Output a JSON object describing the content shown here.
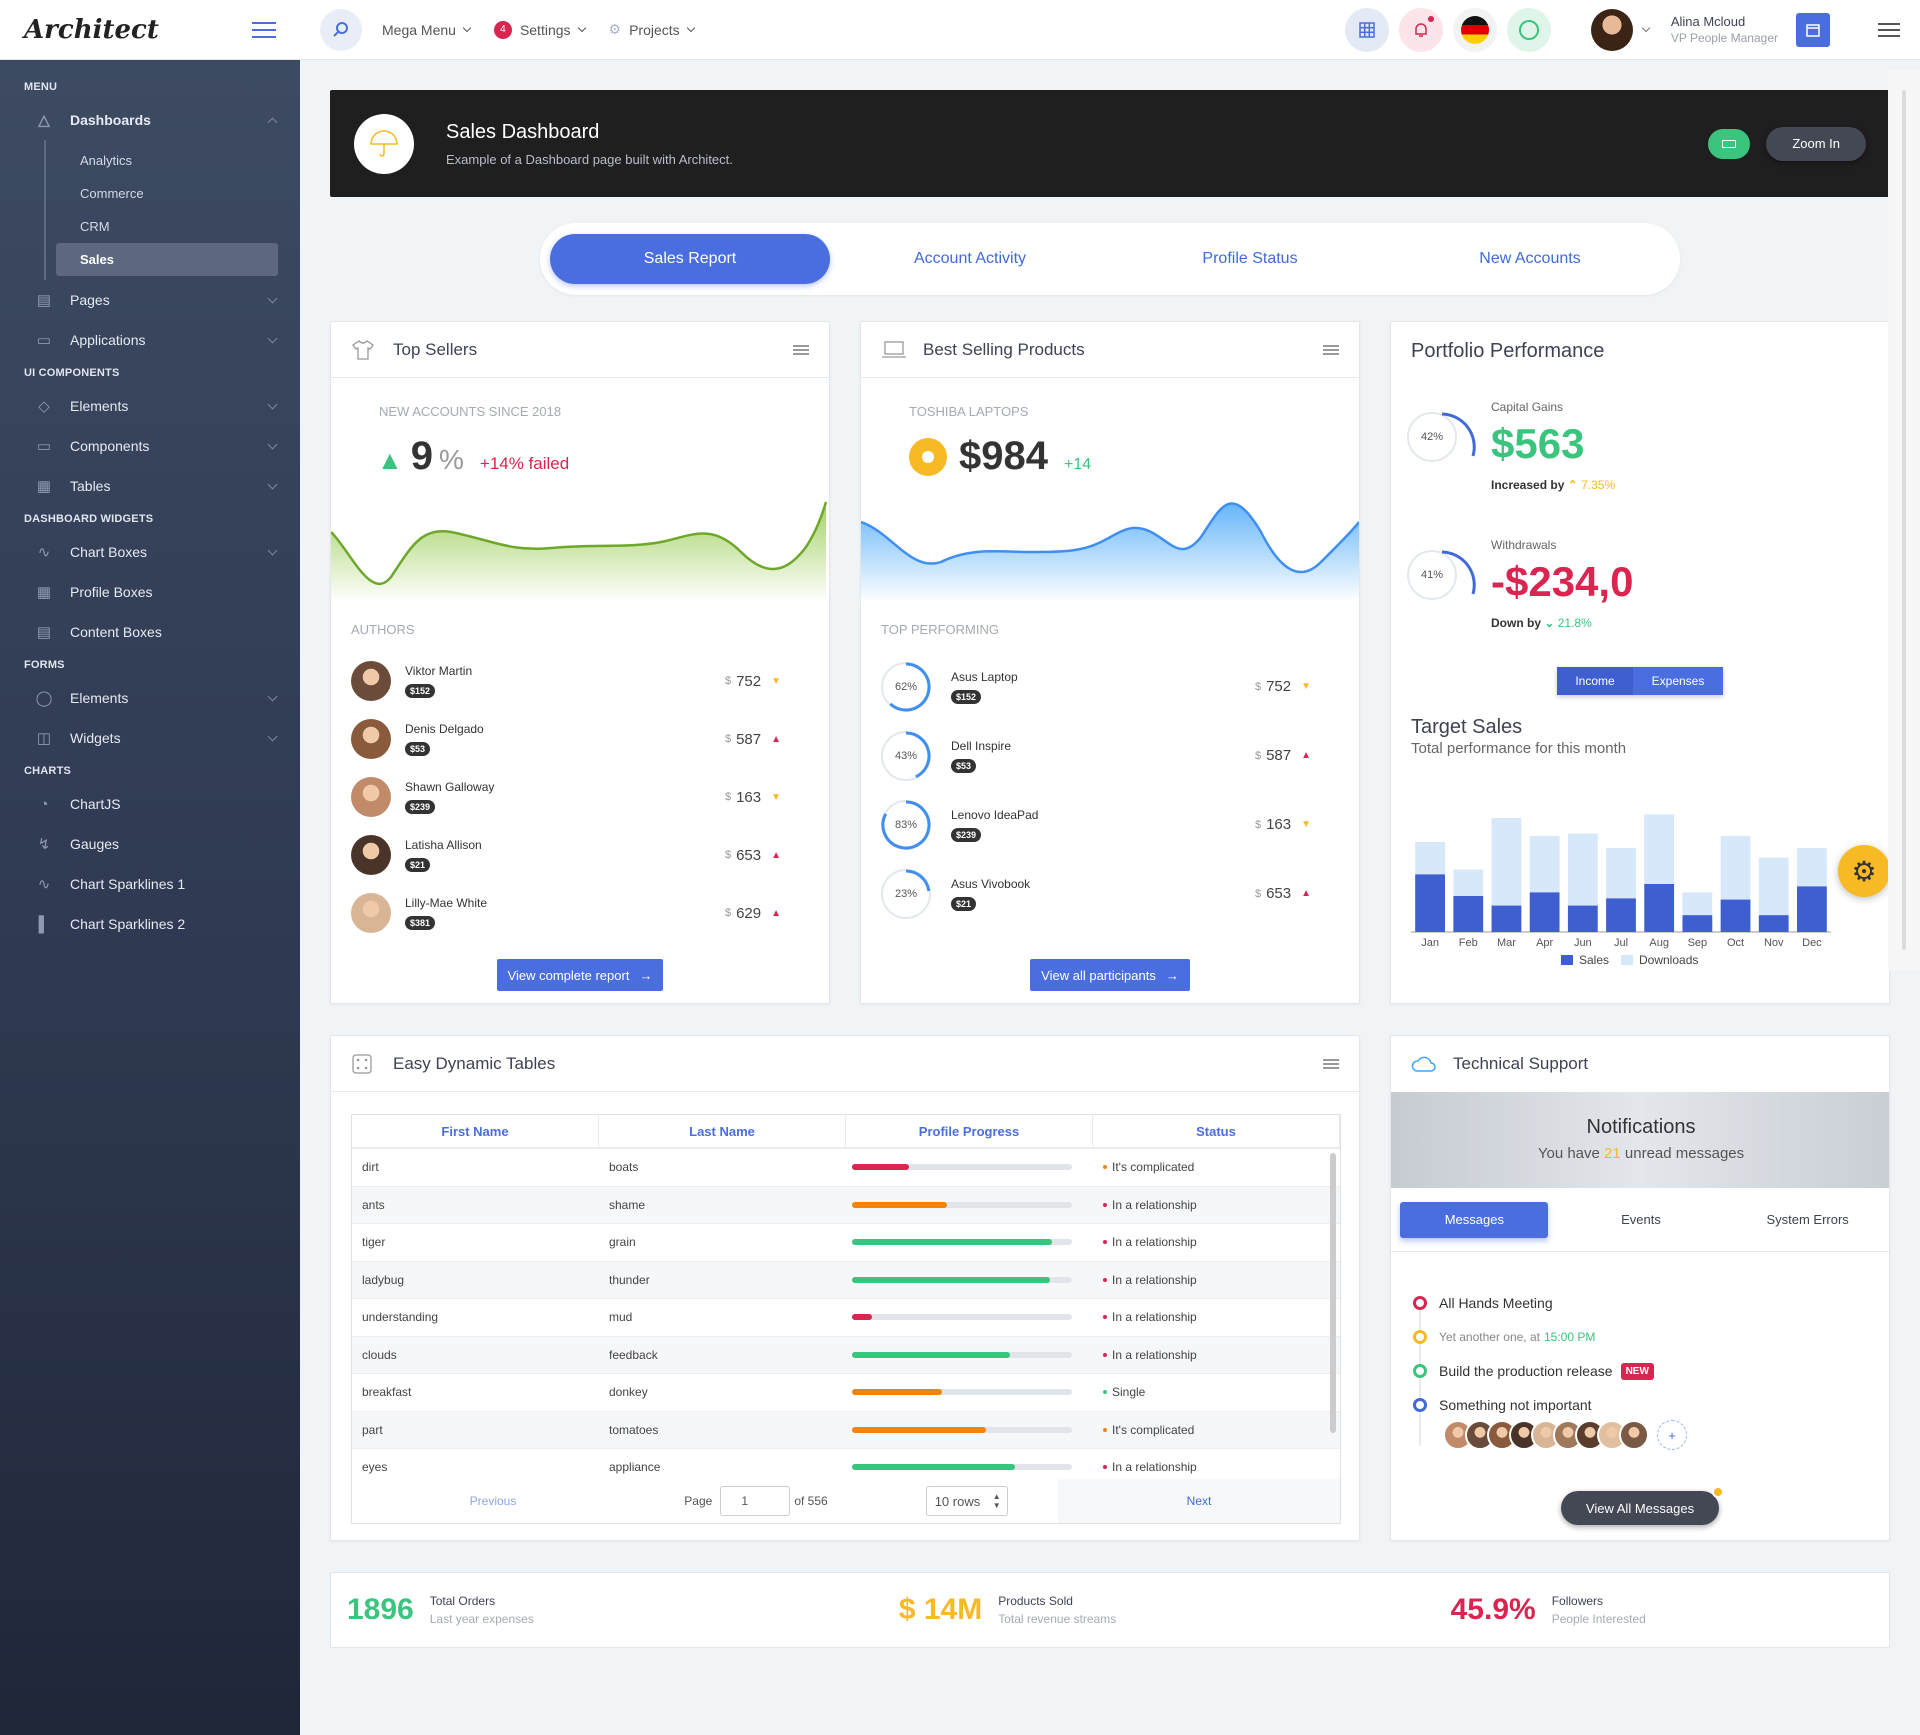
{
  "app": {
    "logo": "Architect"
  },
  "sidebar": {
    "headings": [
      "Menu",
      "UI Components",
      "Dashboard Widgets",
      "Forms",
      "Charts"
    ],
    "dashboards": {
      "label": "Dashboards",
      "children": [
        "Analytics",
        "Commerce",
        "CRM",
        "Sales"
      ]
    },
    "menu_items": [
      "Pages",
      "Applications"
    ],
    "ui_items": [
      "Elements",
      "Components",
      "Tables"
    ],
    "widget_items": [
      "Chart Boxes",
      "Profile Boxes",
      "Content Boxes"
    ],
    "form_items": [
      "Elements",
      "Widgets"
    ],
    "chart_items": [
      "ChartJS",
      "Gauges",
      "Chart Sparklines 1",
      "Chart Sparklines 2"
    ]
  },
  "topbar": {
    "mega_menu": "Mega Menu",
    "settings": "Settings",
    "settings_badge": "4",
    "projects": "Projects",
    "user_name": "Alina Mcloud",
    "user_role": "VP People Manager"
  },
  "banner": {
    "title": "Sales Dashboard",
    "subtitle": "Example of a Dashboard page built with Architect.",
    "zoom": "Zoom In"
  },
  "tabs": [
    "Sales Report",
    "Account Activity",
    "Profile Status",
    "New Accounts"
  ],
  "top_sellers": {
    "title": "Top Sellers",
    "caption": "New accounts since 2018",
    "value": "9",
    "unit": "%",
    "change": "+14% failed",
    "authors_label": "Authors",
    "authors": [
      {
        "name": "Viktor Martin",
        "pill": "$152",
        "amount": "752",
        "dir": "down"
      },
      {
        "name": "Denis Delgado",
        "pill": "$53",
        "amount": "587",
        "dir": "up"
      },
      {
        "name": "Shawn Galloway",
        "pill": "$239",
        "amount": "163",
        "dir": "down"
      },
      {
        "name": "Latisha Allison",
        "pill": "$21",
        "amount": "653",
        "dir": "up"
      },
      {
        "name": "Lilly-Mae White",
        "pill": "$381",
        "amount": "629",
        "dir": "up"
      }
    ],
    "button": "View complete report"
  },
  "best_selling": {
    "title": "Best Selling Products",
    "caption": "Toshiba Laptops",
    "value": "$984",
    "change": "+14",
    "performing_label": "Top Performing",
    "products": [
      {
        "pct": "62%",
        "name": "Asus Laptop",
        "pill": "$152",
        "amount": "752",
        "dir": "down"
      },
      {
        "pct": "43%",
        "name": "Dell Inspire",
        "pill": "$53",
        "amount": "587",
        "dir": "up"
      },
      {
        "pct": "83%",
        "name": "Lenovo IdeaPad",
        "pill": "$239",
        "amount": "163",
        "dir": "down"
      },
      {
        "pct": "23%",
        "name": "Asus Vivobook",
        "pill": "$21",
        "amount": "653",
        "dir": "up"
      }
    ],
    "button": "View all participants"
  },
  "portfolio": {
    "title": "Portfolio Performance",
    "capital": {
      "pct": "42%",
      "label": "Capital Gains",
      "value": "$563",
      "sub": "Increased by",
      "delta": "7.35%"
    },
    "withdrawals": {
      "pct": "41%",
      "label": "Withdrawals",
      "value": "-$234,0",
      "sub": "Down by",
      "delta": "21.8%"
    },
    "toggle": [
      "Income",
      "Expenses"
    ],
    "target_title": "Target Sales",
    "target_sub": "Total performance for this month"
  },
  "chart_data": {
    "type": "bar",
    "categories": [
      "Jan",
      "Feb",
      "Mar",
      "Apr",
      "Jun",
      "Jul",
      "Aug",
      "Sep",
      "Oct",
      "Nov",
      "Dec"
    ],
    "series": [
      {
        "name": "Sales",
        "values": [
          48,
          30,
          22,
          33,
          22,
          28,
          40,
          14,
          27,
          14,
          38
        ],
        "color": "#3f5fd1"
      },
      {
        "name": "Downloads",
        "values": [
          75,
          52,
          95,
          80,
          82,
          70,
          98,
          33,
          80,
          62,
          70
        ],
        "color": "#d6e8f9"
      }
    ],
    "legend": "bottom"
  },
  "tables": {
    "title": "Easy Dynamic Tables",
    "headers": [
      "First Name",
      "Last Name",
      "Profile Progress",
      "Status"
    ],
    "rows": [
      {
        "first": "dirt",
        "last": "boats",
        "progress": 0.26,
        "color": "#d92550",
        "status": "It's complicated",
        "dot": "#f0840c"
      },
      {
        "first": "ants",
        "last": "shame",
        "progress": 0.43,
        "color": "#f0840c",
        "status": "In a relationship",
        "dot": "#d92550"
      },
      {
        "first": "tiger",
        "last": "grain",
        "progress": 0.91,
        "color": "#3ac47d",
        "status": "In a relationship",
        "dot": "#d92550"
      },
      {
        "first": "ladybug",
        "last": "thunder",
        "progress": 0.9,
        "color": "#3ac47d",
        "status": "In a relationship",
        "dot": "#d92550"
      },
      {
        "first": "understanding",
        "last": "mud",
        "progress": 0.09,
        "color": "#d92550",
        "status": "In a relationship",
        "dot": "#d92550"
      },
      {
        "first": "clouds",
        "last": "feedback",
        "progress": 0.72,
        "color": "#3ac47d",
        "status": "In a relationship",
        "dot": "#d92550"
      },
      {
        "first": "breakfast",
        "last": "donkey",
        "progress": 0.41,
        "color": "#f0840c",
        "status": "Single",
        "dot": "#3ac47d"
      },
      {
        "first": "part",
        "last": "tomatoes",
        "progress": 0.61,
        "color": "#f0840c",
        "status": "It's complicated",
        "dot": "#f0840c"
      },
      {
        "first": "eyes",
        "last": "appliance",
        "progress": 0.74,
        "color": "#3ac47d",
        "status": "In a relationship",
        "dot": "#d92550"
      }
    ],
    "previous": "Previous",
    "page_label": "Page",
    "page": "1",
    "of": "of 556",
    "rows_select": "10 rows",
    "next": "Next"
  },
  "support": {
    "title": "Technical Support",
    "notif_title": "Notifications",
    "notif_pre": "You have",
    "notif_count": "21",
    "notif_post": "unread messages",
    "tabs": [
      "Messages",
      "Events",
      "System Errors"
    ],
    "timeline": [
      {
        "text": "All Hands Meeting",
        "color": "#d92550"
      },
      {
        "text": "Yet another one, at",
        "time": "15:00 PM",
        "color": "#f7b924"
      },
      {
        "text": "Build the production release",
        "badge": "NEW",
        "color": "#3ac47d"
      },
      {
        "text": "Something not important",
        "color": "#3f6ad8"
      }
    ],
    "plus": "+",
    "button": "View All Messages"
  },
  "kpis": [
    {
      "value": "1896",
      "label": "Total Orders",
      "sub": "Last year expenses",
      "color": "#3ac47d"
    },
    {
      "value": "$ 14M",
      "label": "Products Sold",
      "sub": "Total revenue streams",
      "color": "#f7b924"
    },
    {
      "value": "45.9%",
      "label": "Followers",
      "sub": "People Interested",
      "color": "#d92550"
    }
  ]
}
